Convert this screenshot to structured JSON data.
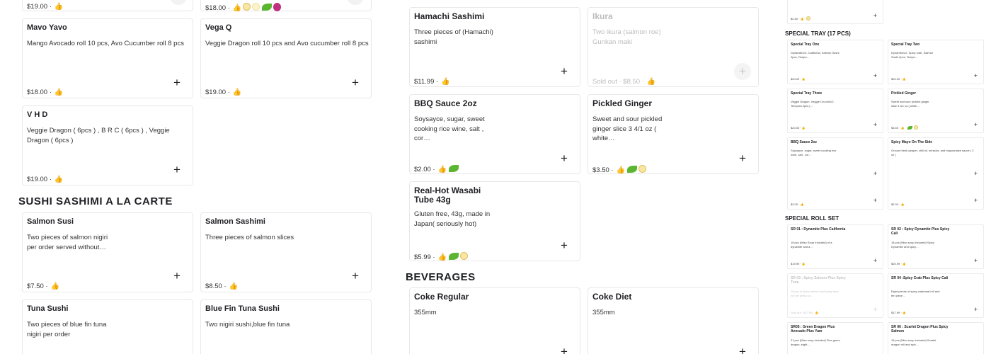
{
  "left_top": {
    "price_a": "$19.00 ·",
    "price_b": "$18.00 ·"
  },
  "left_cards": [
    {
      "title": "Mavo Yavo",
      "desc": "Mango Avocado roll 10 pcs, Avo Cucumber roll 8 pcs",
      "price": "$18.00 ·"
    },
    {
      "title": "Vega Q",
      "desc": "Veggie Dragon roll 10 pcs and Avo cucumber roll 8 pcs",
      "price": "$19.00 ·"
    },
    {
      "title": "V H D",
      "desc": "Veggie Dragon ( 6pcs ) , B R C ( 6pcs ) , Veggie Dragon ( 6pcs )",
      "price": "$19.00 ·"
    }
  ],
  "section_sushi": "Sushi Sashimi A La Carte",
  "sushi_cards": [
    {
      "title": "Salmon Susi",
      "desc": "Two pieces of salmon nigiri per order served without…",
      "price": "$7.50 ·"
    },
    {
      "title": "Salmon Sashimi",
      "desc": "Three pieces of salmon slices",
      "price": "$8.50 ·"
    },
    {
      "title": "Tuna Sushi",
      "desc": "Two pieces of blue fin tuna nigiri per order",
      "price": ""
    },
    {
      "title": "Blue Fin Tuna Sushi",
      "desc": "Two nigiri sushi,blue fin tuna",
      "price": ""
    }
  ],
  "mid_cards": [
    {
      "title": "Hamachi Sashimi",
      "desc": "Three pieces of (Hamachi) sashimi",
      "price": "$11.99 ·"
    },
    {
      "title": "Ikura",
      "desc": "Two ikura (salmon roe) Gunkan maki",
      "price": "Sold out · $8.50 ·"
    },
    {
      "title": "BBQ Sauce 2oz",
      "desc": "Soysayce, sugar, sweet cooking rice wine, salt , cor…",
      "price": "$2.00 ·"
    },
    {
      "title": "Pickled Ginger",
      "desc": "Sweet and sour pickled ginger slice 3 4/1 oz ( white…",
      "price": "$3.50 ·"
    },
    {
      "title": "Real-Hot Wasabi Tube 43g",
      "desc": "Gluten free, 43g, made in Japan( seriously hot)",
      "price": "$5.99 ·"
    }
  ],
  "section_bev": "Beverages",
  "bev_cards": [
    {
      "title": "Coke Regular",
      "desc": "355mm"
    },
    {
      "title": "Coke Diet",
      "desc": "355mm"
    }
  ],
  "mini": {
    "top_price": "$2.50 ·",
    "section_tray": "Special Tray (17 pcs)",
    "tray": [
      {
        "title": "Special Tray One",
        "desc": "Dynamite1/2, California, Salmon Sushi 2pcs, Tempu…",
        "price": "$20.00 ·"
      },
      {
        "title": "Special Tray Two",
        "desc": "Dynamite1/2, Spicy crab, Salmon Sushi 2pcs, Tempu…",
        "price": "$20.00 ·"
      },
      {
        "title": "Special Tray Three",
        "desc": "Veggie Dragon, Veggie Crunch1/2, Tempura 2pcs (…",
        "price": "$20.00 ·"
      },
      {
        "title": "Pickled Ginger",
        "desc": "Sweet and sour pickled ginger slice 3 4/1 oz ( white…",
        "price": "$3.50 ·"
      },
      {
        "title": "BBQ Sauce 2oz",
        "desc": "Soysayce, sugar, sweet cooking rice wine, salt , cor…",
        "price": "$2.00 ·"
      },
      {
        "title": "Spicy Mayo On The Side",
        "desc": "Ground fresh pepper, chili oil, sriracha, and mayonnaise sauce ( 2 oz )",
        "price": "$2.00 ·"
      }
    ],
    "section_roll": "Special Roll Set",
    "roll": [
      {
        "title": "SR 01 : Dynamite Plus California",
        "desc": "18 pcs (Miso Soup Included) of a dynamite and a…",
        "price": "$19.99 ·"
      },
      {
        "title": "SR 02 : Spicy Dynamite Plus Spicy Cali",
        "desc": "18 pcs (Miso soup included) Spicy Dynamite and spicy…",
        "price": "$20.99 ·"
      },
      {
        "title": "SR 03 : Spicy Salmon Plus Spicy Tuna",
        "desc": "16 pcs of spicy salmon and spicy tuna roll set (Miso so…",
        "price": "Sold out · $17.99 ·"
      },
      {
        "title": "SR 04 :Spicy Crab Plus Spicy Cali",
        "desc": "Eight pieces of spicy crabmeat roll and ten piece…",
        "price": "$17.99 ·"
      },
      {
        "title": "SR05 : Green Dragon Plus Avocado Plus Yam",
        "desc": "21 pcs (Miso soup included) Five green dragon, eight…",
        "price": ""
      },
      {
        "title": "SR 06 : Scarlet Dragon Plus Spicy Salmon",
        "desc": "18 pcs (Miso soup included) Scarlet dragon roll and spic…",
        "price": ""
      }
    ]
  }
}
